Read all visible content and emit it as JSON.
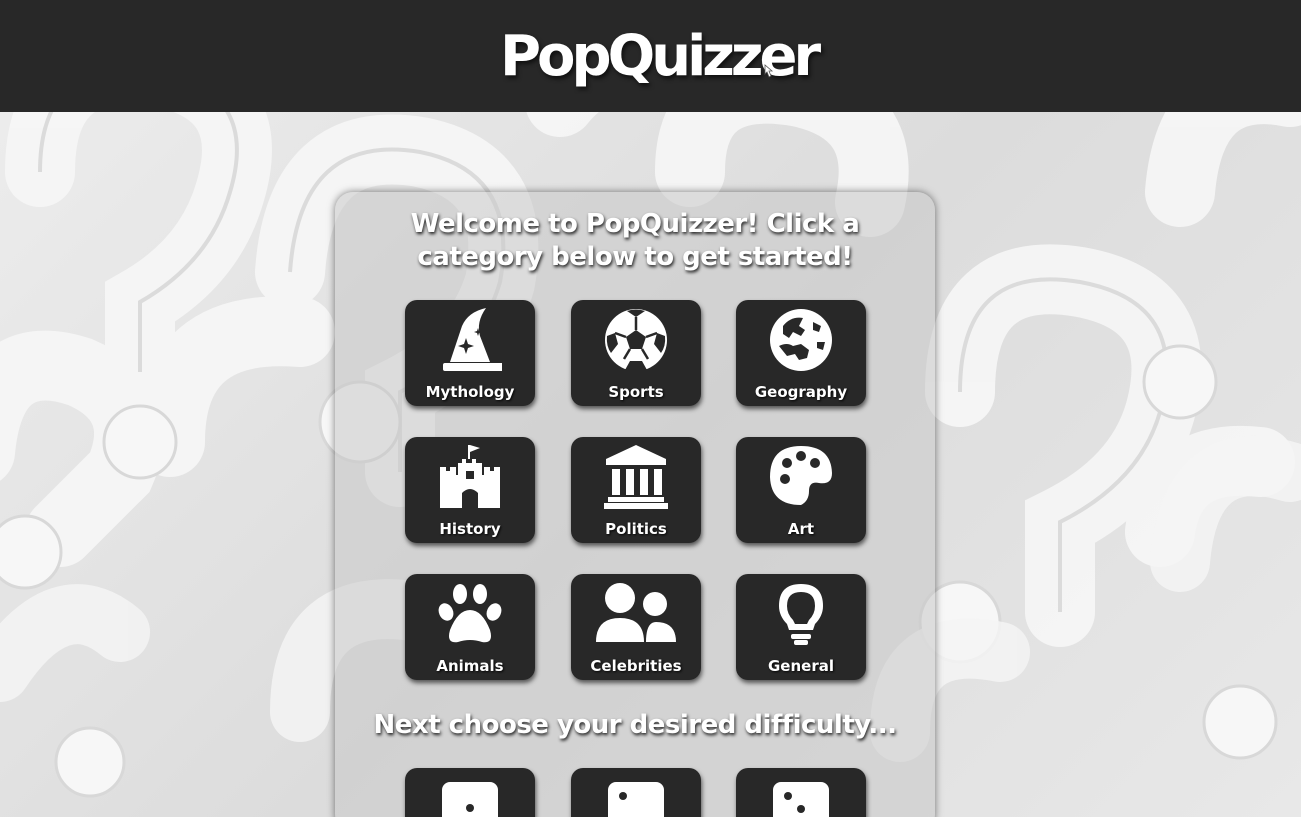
{
  "app": {
    "logo_text": "PopQuizzer"
  },
  "main": {
    "welcome_text": "Welcome to PopQuizzer! Click a category below to get started!",
    "difficulty_heading": "Next choose your desired difficulty...",
    "categories": [
      {
        "label": "Mythology",
        "icon": "wizard-hat-icon"
      },
      {
        "label": "Sports",
        "icon": "soccer-ball-icon"
      },
      {
        "label": "Geography",
        "icon": "globe-icon"
      },
      {
        "label": "History",
        "icon": "castle-icon"
      },
      {
        "label": "Politics",
        "icon": "landmark-icon"
      },
      {
        "label": "Art",
        "icon": "palette-icon"
      },
      {
        "label": "Animals",
        "icon": "paw-icon"
      },
      {
        "label": "Celebrities",
        "icon": "users-icon"
      },
      {
        "label": "General",
        "icon": "lightbulb-icon"
      }
    ],
    "difficulties": [
      {
        "icon": "dice-one-icon"
      },
      {
        "icon": "dice-two-icon"
      },
      {
        "icon": "dice-three-icon"
      }
    ]
  },
  "colors": {
    "header_bg": "#282828",
    "tile_bg": "#282828",
    "text": "#ffffff"
  }
}
